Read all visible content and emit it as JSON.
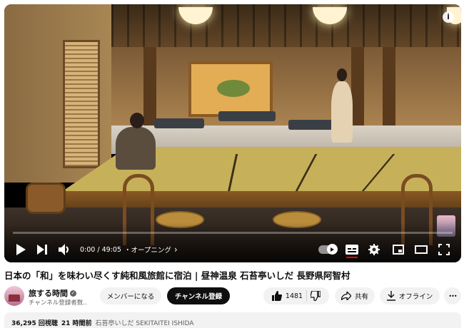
{
  "player": {
    "time_current": "0:00",
    "time_total": "49:05",
    "time_separator": " / ",
    "chapter": "・オープニング",
    "chapter_chevron": "›",
    "progress_fraction": 0.0,
    "info_glyph": "i",
    "autoplay_on": true
  },
  "video": {
    "title": "日本の「和」を味わい尽くす純和風旅館に宿泊 | 昼神温泉 石苔亭いしだ 長野県阿智村"
  },
  "channel": {
    "name": "旅する時間",
    "verified_glyph": "✓",
    "subscribers": "チャンネル登録者数..."
  },
  "actions": {
    "member_label": "メンバーになる",
    "subscribe_label": "チャンネル登録",
    "like_count": "1481",
    "share_label": "共有",
    "offline_label": "オフライン",
    "more_glyph": "•••"
  },
  "description": {
    "views": "36,295 回視聴",
    "time_ago": "21 時間前",
    "tag": "石苔亭いしだ SEKITAITEI ISHIDA"
  },
  "colors": {
    "accent": "#ff0000",
    "dark_button": "#0f0f0f",
    "pill_bg": "#f2f2f2"
  },
  "icons": [
    "play-icon",
    "next-icon",
    "volume-icon",
    "autoplay-toggle",
    "captions-icon",
    "settings-gear-icon",
    "miniplayer-icon",
    "theater-icon",
    "fullscreen-icon",
    "thumbs-up-icon",
    "thumbs-down-icon",
    "share-arrow-icon",
    "download-icon",
    "more-icon",
    "info-icon"
  ]
}
